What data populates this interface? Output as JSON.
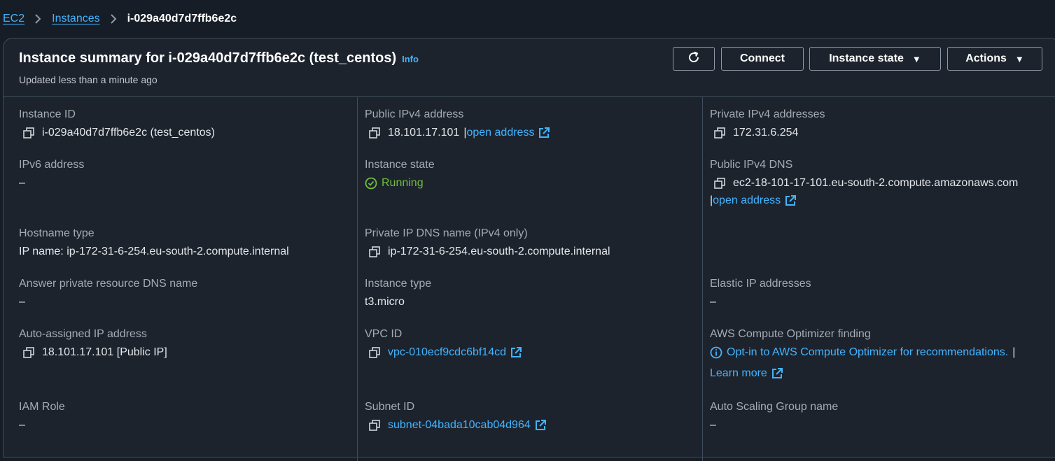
{
  "breadcrumb": {
    "ec2": "EC2",
    "instances": "Instances",
    "current": "i-029a40d7d7ffb6e2c"
  },
  "header": {
    "title": "Instance summary for i-029a40d7d7ffb6e2c (test_centos)",
    "info": "Info",
    "subtitle": "Updated less than a minute ago",
    "buttons": {
      "connect": "Connect",
      "instance_state": "Instance state",
      "actions": "Actions"
    }
  },
  "fields": {
    "instance_id": {
      "label": "Instance ID",
      "value": "i-029a40d7d7ffb6e2c (test_centos)"
    },
    "public_ipv4": {
      "label": "Public IPv4 address",
      "value": "18.101.17.101",
      "link": "open address"
    },
    "private_ipv4": {
      "label": "Private IPv4 addresses",
      "value": "172.31.6.254"
    },
    "ipv6": {
      "label": "IPv6 address",
      "value": "–"
    },
    "instance_state": {
      "label": "Instance state",
      "value": "Running"
    },
    "public_dns": {
      "label": "Public IPv4 DNS",
      "value": "ec2-18-101-17-101.eu-south-2.compute.amazonaws.com",
      "link": "open address"
    },
    "hostname_type": {
      "label": "Hostname type",
      "value": "IP name: ip-172-31-6-254.eu-south-2.compute.internal"
    },
    "private_dns": {
      "label": "Private IP DNS name (IPv4 only)",
      "value": "ip-172-31-6-254.eu-south-2.compute.internal"
    },
    "answer_dns": {
      "label": "Answer private resource DNS name",
      "value": "–"
    },
    "instance_type": {
      "label": "Instance type",
      "value": "t3.micro"
    },
    "elastic_ip": {
      "label": "Elastic IP addresses",
      "value": "–"
    },
    "auto_ip": {
      "label": "Auto-assigned IP address",
      "value": "18.101.17.101 [Public IP]"
    },
    "vpc_id": {
      "label": "VPC ID",
      "value": "vpc-010ecf9cdc6bf14cd"
    },
    "optimizer": {
      "label": "AWS Compute Optimizer finding",
      "value": "Opt-in to AWS Compute Optimizer for recommendations.",
      "learn_more": "Learn more"
    },
    "iam_role": {
      "label": "IAM Role",
      "value": "–"
    },
    "subnet_id": {
      "label": "Subnet ID",
      "value": "subnet-04bada10cab04d964"
    },
    "asg_name": {
      "label": "Auto Scaling Group name",
      "value": "–"
    }
  },
  "colors": {
    "link": "#42b4ff",
    "success": "#6fbf3a",
    "background": "#161d26",
    "panel": "#1c232d"
  },
  "icons": [
    "chevron-right-icon",
    "refresh-icon",
    "caret-down-icon",
    "copy-icon",
    "external-link-icon",
    "check-circle-icon",
    "info-circle-icon"
  ]
}
